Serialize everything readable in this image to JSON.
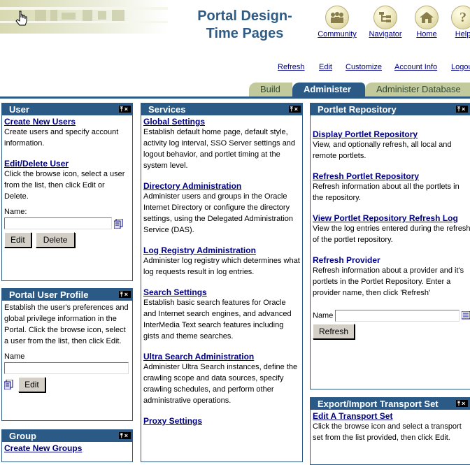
{
  "header": {
    "title_line1": "Portal Design-",
    "title_line2": "Time Pages",
    "nav": [
      {
        "label": "Community",
        "icon": "community-icon"
      },
      {
        "label": "Navigator",
        "icon": "navigator-icon"
      },
      {
        "label": "Home",
        "icon": "home-icon"
      },
      {
        "label": "Help",
        "icon": "help-icon"
      }
    ],
    "links": [
      "Refresh",
      "Edit",
      "Customize",
      "Account Info",
      "Logout"
    ]
  },
  "tabs": [
    {
      "label": "Build",
      "active": false
    },
    {
      "label": "Administer",
      "active": true
    },
    {
      "label": "Administer Database",
      "active": false
    }
  ],
  "user": {
    "title": "User",
    "create_link": "Create New Users",
    "create_desc": "Create users and specify account information.",
    "edit_link": "Edit/Delete User",
    "edit_desc": "Click the browse icon, select a user from the list, then click Edit or Delete.",
    "name_label": "Name:",
    "edit_btn": "Edit",
    "delete_btn": "Delete"
  },
  "profile": {
    "title": "Portal User Profile",
    "desc": "Establish the user's preferences and global privilege information in the Portal. Click the browse icon, select a user from the list, then click Edit.",
    "name_label": "Name",
    "edit_btn": "Edit"
  },
  "group": {
    "title": "Group",
    "create_link": "Create New Groups"
  },
  "services": {
    "title": "Services",
    "items": [
      {
        "link": "Global Settings",
        "desc": "Establish default home page, default style, activity log interval, SSO Server settings and logout behavior, and portlet timing at the system level."
      },
      {
        "link": "Directory Administration",
        "desc": "Administer users and groups in the Oracle Internet Directory or configure the directory settings, using the Delegated Administration Service (DAS)."
      },
      {
        "link": "Log Registry Administration",
        "desc": "Administer log registry which determines what log requests result in log entries."
      },
      {
        "link": "Search Settings",
        "desc": "Establish basic search features for Oracle and Internet search engines, and advanced InterMedia Text search features including gists and theme searches."
      },
      {
        "link": "Ultra Search Administration",
        "desc": "Administer Ultra Search instances, define the crawling scope and data sources, specify crawling schedules, and perform other administrative operations."
      },
      {
        "link": "Proxy Settings",
        "desc": ""
      }
    ]
  },
  "repository": {
    "title": "Portlet Repository",
    "display_link": "Display Portlet Repository",
    "display_desc": "View, and optionally refresh, all local and remote portlets.",
    "refresh_link": "Refresh Portlet Repository",
    "refresh_desc": "Refresh information about all the portlets in the repository.",
    "log_link": "View Portlet Repository Refresh Log",
    "log_desc": "View the log entries entered during the refresh of the portlet repository.",
    "provider_heading": "Refresh Provider",
    "provider_desc": "Refresh information about a provider and it's portlets in the Portlet Repository. Enter a provider name, then click 'Refresh'",
    "name_label": "Name",
    "refresh_btn": "Refresh"
  },
  "transport": {
    "title": "Export/Import Transport Set",
    "edit_link": "Edit A Transport Set",
    "edit_desc": "Click the browse icon and select a transport set from the list provided, then click Edit."
  },
  "colors": {
    "accent": "#2b5a86",
    "tab_inactive": "#c2c99c",
    "title": "#2f5b85",
    "link": "#000080"
  }
}
